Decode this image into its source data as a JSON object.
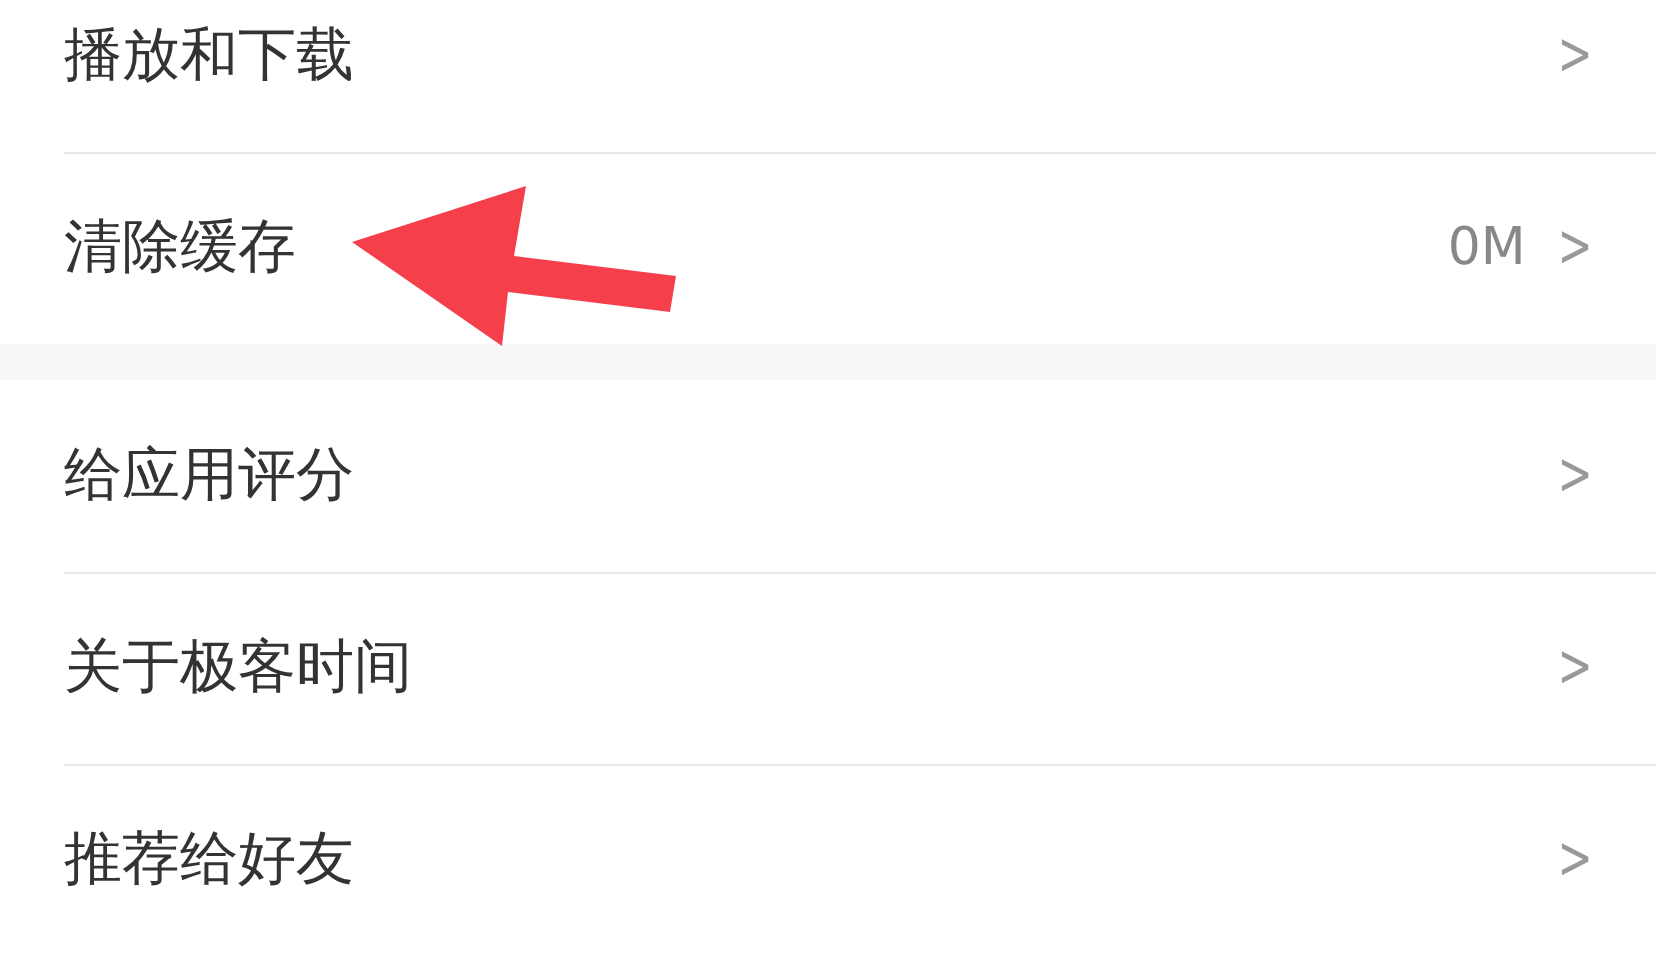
{
  "groups": [
    {
      "rows": [
        {
          "label": "播放和下载",
          "chevron": ">"
        },
        {
          "label": "清除缓存",
          "value": "0M",
          "chevron": ">"
        }
      ]
    },
    {
      "rows": [
        {
          "label": "给应用评分",
          "chevron": ">"
        },
        {
          "label": "关于极客时间",
          "chevron": ">"
        },
        {
          "label": "推荐给好友",
          "chevron": ">"
        }
      ]
    }
  ],
  "annotations": [
    {
      "kind": "arrow"
    }
  ]
}
